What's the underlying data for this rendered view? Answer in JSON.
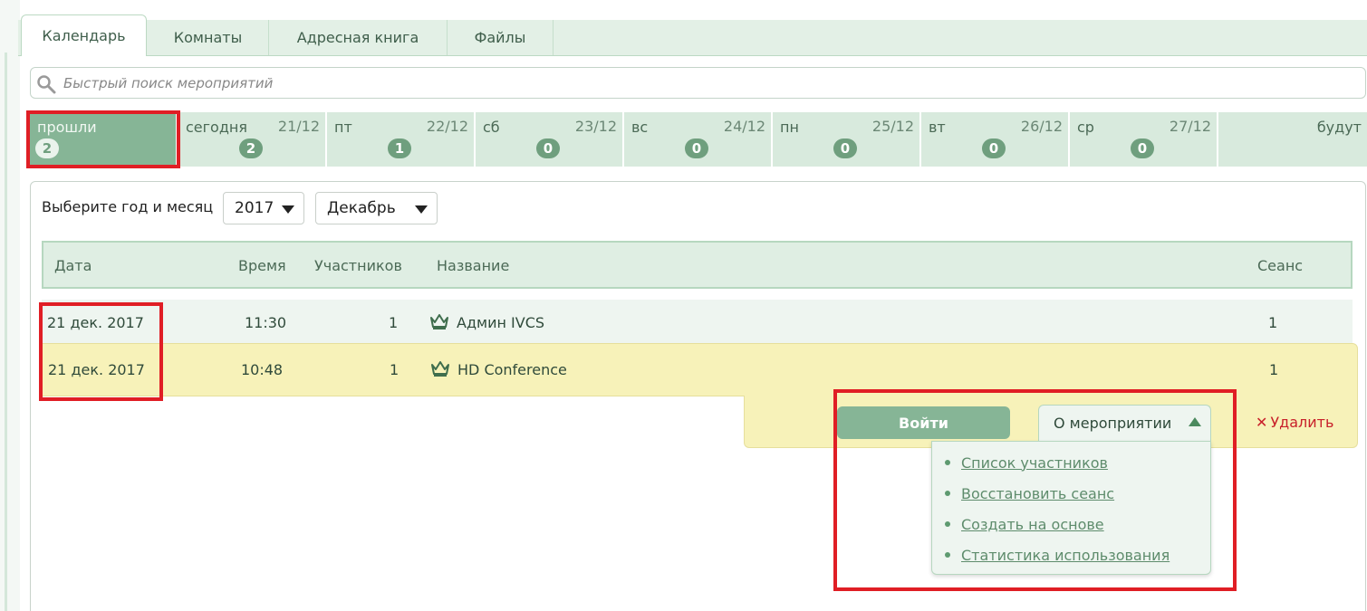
{
  "tabs": [
    {
      "label": "Календарь",
      "active": true
    },
    {
      "label": "Комнаты",
      "active": false
    },
    {
      "label": "Адресная книга",
      "active": false
    },
    {
      "label": "Файлы",
      "active": false
    }
  ],
  "search": {
    "placeholder": "Быстрый поиск мероприятий",
    "value": ""
  },
  "days": [
    {
      "name": "прошли",
      "date": "",
      "count": "2"
    },
    {
      "name": "сегодня",
      "date": "21/12",
      "count": "2"
    },
    {
      "name": "пт",
      "date": "22/12",
      "count": "1"
    },
    {
      "name": "сб",
      "date": "23/12",
      "count": "0"
    },
    {
      "name": "вс",
      "date": "24/12",
      "count": "0"
    },
    {
      "name": "пн",
      "date": "25/12",
      "count": "0"
    },
    {
      "name": "вт",
      "date": "26/12",
      "count": "0"
    },
    {
      "name": "ср",
      "date": "27/12",
      "count": "0"
    },
    {
      "name": "будут",
      "date": "",
      "count": ""
    }
  ],
  "filter": {
    "label": "Выберите год и месяц",
    "year": "2017",
    "month": "Декабрь"
  },
  "table": {
    "headers": {
      "date": "Дата",
      "time": "Время",
      "participants": "Участников",
      "name": "Название",
      "session": "Сеанс"
    },
    "rows": [
      {
        "date": "21 дек. 2017",
        "time": "11:30",
        "participants": "1",
        "name": "Админ IVCS",
        "session": "1"
      },
      {
        "date": "21 дек. 2017",
        "time": "10:48",
        "participants": "1",
        "name": "HD Conference",
        "session": "1"
      }
    ]
  },
  "actions": {
    "join": "Войти",
    "about": "О мероприятии",
    "delete": "Удалить",
    "menu": [
      "Список участников",
      "Восстановить сеанс",
      "Создать на основе",
      "Статистика использования"
    ]
  },
  "colors": {
    "accent": "#86b596",
    "highlight": "#e01e25",
    "selected_row": "#f7f2b9",
    "delete": "#c8202a"
  }
}
